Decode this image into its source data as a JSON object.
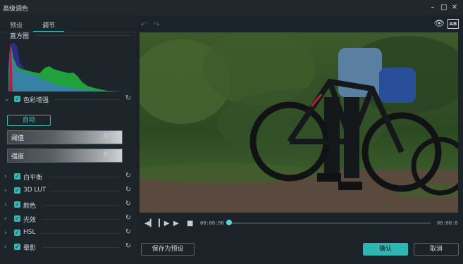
{
  "window": {
    "title": "高级调色"
  },
  "tabs": {
    "preset": "预设",
    "adjust": "调节"
  },
  "histogram": {
    "label": "直方图"
  },
  "color_enhance": {
    "label": "色彩增强",
    "auto_label": "自动"
  },
  "sliders": [
    {
      "label": "阈值",
      "value": "0"
    },
    {
      "label": "强度",
      "value": "0"
    }
  ],
  "sections": [
    {
      "label": "白平衡"
    },
    {
      "label": "3D LUT"
    },
    {
      "label": "颜色"
    },
    {
      "label": "光效"
    },
    {
      "label": "HSL"
    },
    {
      "label": "晕影"
    }
  ],
  "playback": {
    "current_time": "00:00:00",
    "total_time": "00:00:0",
    "progress": 0
  },
  "buttons": {
    "save_preset": "保存为预设",
    "ok": "确认",
    "cancel": "取消"
  },
  "icons": {
    "compare_ab": "AB"
  },
  "colors": {
    "accent": "#3fb4b5",
    "primary_button": "#2fb6b2"
  }
}
